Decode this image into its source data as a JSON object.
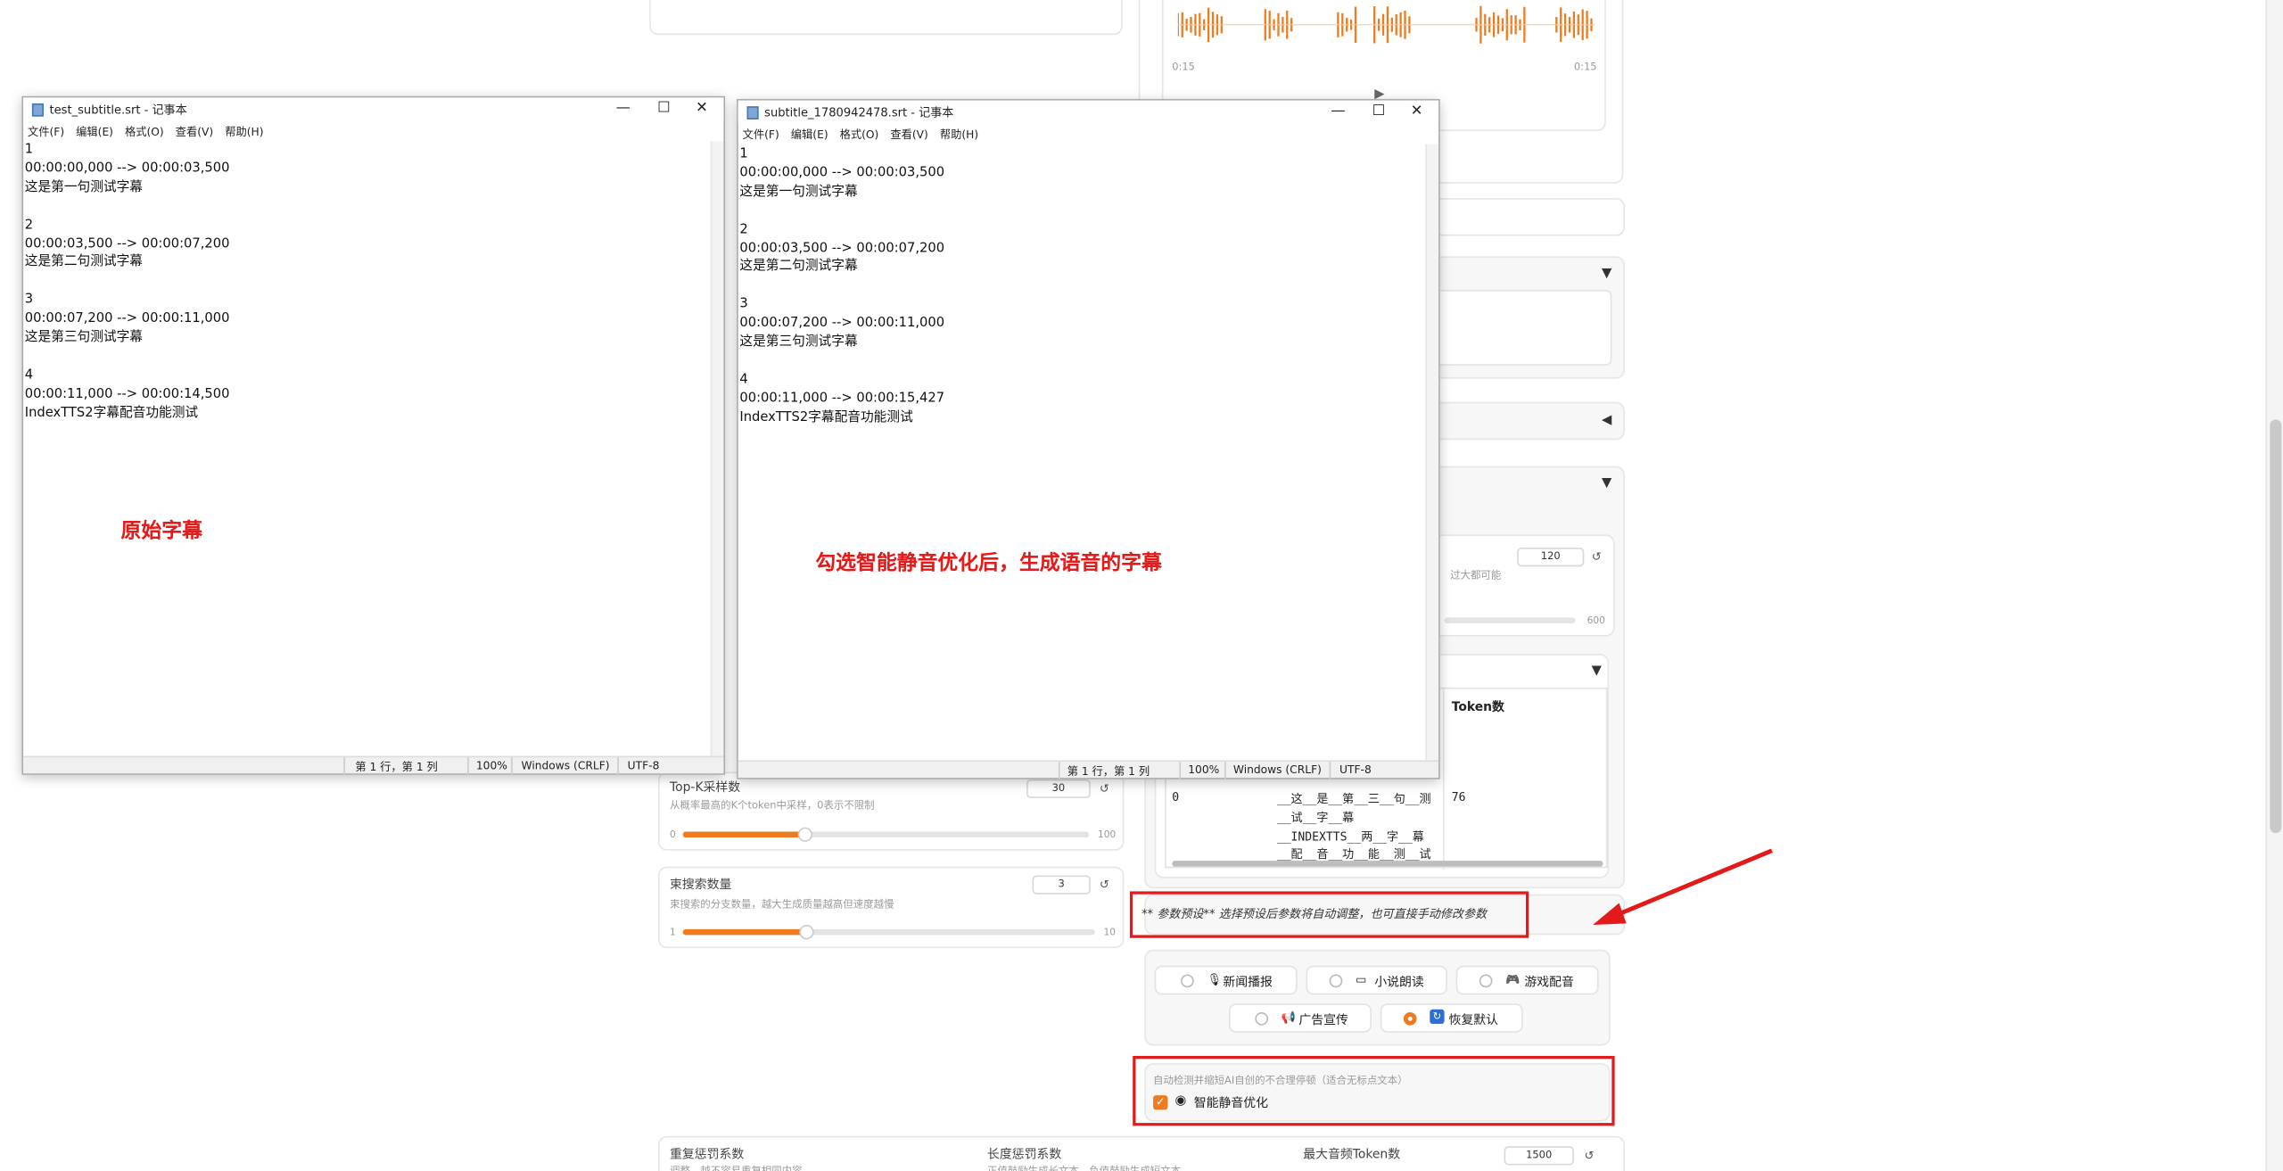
{
  "audio": {
    "time_left": "0:15",
    "time_right": "0:15"
  },
  "topk": {
    "label": "Top-K采样数",
    "hint": "从概率最高的K个token中采样，0表示不限制",
    "value": "30",
    "min": "0",
    "max": "100",
    "fraction": 0.3
  },
  "beams": {
    "label": "束搜索数量",
    "hint": "束搜索的分支数量，越大生成质量越高但速度越慢",
    "value": "3",
    "min": "1",
    "max": "10",
    "fraction": 0.3
  },
  "right_slider": {
    "value": "120",
    "hint": "过大都可能",
    "max": "600"
  },
  "token_table": {
    "header": "Token数",
    "row_index": "0",
    "tokens": [
      "__这__是__第__三__句__测",
      "__试__字__幕",
      "__INDEXTTS__两__字__幕",
      "__配__音__功__能__测__试"
    ],
    "count": "76"
  },
  "preset_note": "** 参数预设** 选择预设后参数将自动调整，也可直接手动修改参数",
  "presets": [
    {
      "label": "新闻播报",
      "icon": "🎙",
      "selected": false
    },
    {
      "label": "小说朗读",
      "icon": "▭",
      "selected": false
    },
    {
      "label": "游戏配音",
      "icon": "🎮",
      "selected": false
    },
    {
      "label": "广告宣传",
      "icon": "📢",
      "selected": false
    },
    {
      "label": "恢复默认",
      "icon": "↻",
      "selected": true
    }
  ],
  "silence": {
    "hint": "自动检测并缩短AI自创的不合理停顿（适合无标点文本）",
    "label": "智能静音优化",
    "checked": true
  },
  "bottom": {
    "rep_label": "重复惩罚系数",
    "rep_hint": "调整，越不容易重复相同内容",
    "len_label": "长度惩罚系数",
    "len_hint": "正值鼓励生成长文本，负值鼓励生成短文本",
    "max_label": "最大音频Token数",
    "max_value": "1500"
  },
  "notepad1": {
    "title": "test_subtitle.srt - 记事本",
    "menu": [
      "文件(F)",
      "编辑(E)",
      "格式(O)",
      "查看(V)",
      "帮助(H)"
    ],
    "content": "1\n00:00:00,000 --> 00:00:03,500\n这是第一句测试字幕\n\n2\n00:00:03,500 --> 00:00:07,200\n这是第二句测试字幕\n\n3\n00:00:07,200 --> 00:00:11,000\n这是第三句测试字幕\n\n4\n00:00:11,000 --> 00:00:14,500\nIndexTTS2字幕配音功能测试",
    "status_pos": "第 1 行，第 1 列",
    "status_zoom": "100%",
    "status_eol": "Windows (CRLF)",
    "status_enc": "UTF-8"
  },
  "notepad2": {
    "title": "subtitle_1780942478.srt - 记事本",
    "menu": [
      "文件(F)",
      "编辑(E)",
      "格式(O)",
      "查看(V)",
      "帮助(H)"
    ],
    "content": "1\n00:00:00,000 --> 00:00:03,500\n这是第一句测试字幕\n\n2\n00:00:03,500 --> 00:00:07,200\n这是第二句测试字幕\n\n3\n00:00:07,200 --> 00:00:11,000\n这是第三句测试字幕\n\n4\n00:00:11,000 --> 00:00:15,427\nIndexTTS2字幕配音功能测试",
    "status_pos": "第 1 行，第 1 列",
    "status_zoom": "100%",
    "status_eol": "Windows (CRLF)",
    "status_enc": "UTF-8"
  },
  "annotations": {
    "left": "原始字幕",
    "right": "勾选智能静音优化后，生成语音的字幕"
  },
  "colors": {
    "accent": "#ee7b1f",
    "annotation": "#e21a1a"
  },
  "window_icons": {
    "minimize": "—",
    "maximize": "☐",
    "close": "✕"
  }
}
